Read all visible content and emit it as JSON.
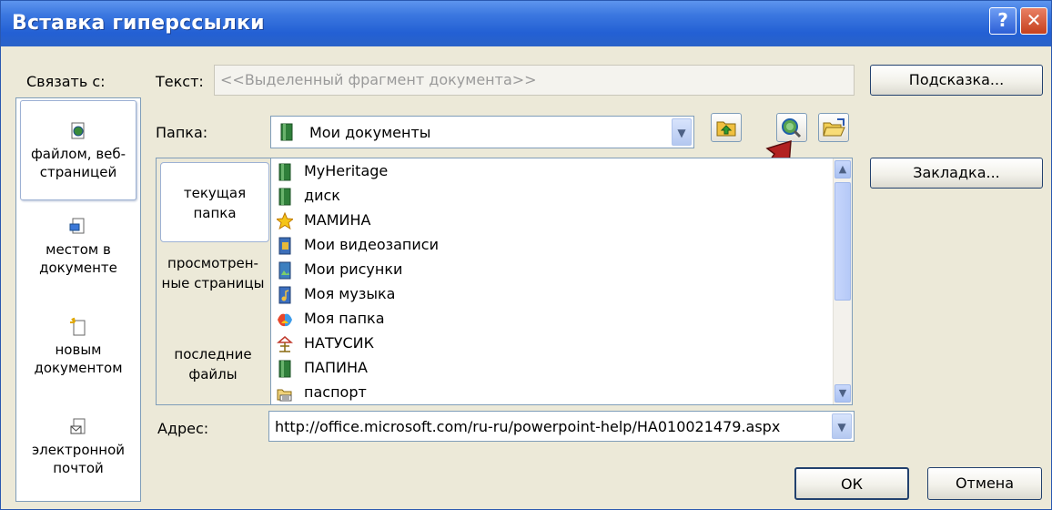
{
  "window": {
    "title": "Вставка гиперссылки",
    "help_glyph": "?",
    "close_glyph": "✕"
  },
  "link_to": {
    "label": "Связать с:",
    "items": [
      {
        "label": "файлом, веб-страницей",
        "icon": "web-page-icon",
        "selected": true
      },
      {
        "label": "местом в документе",
        "icon": "document-place-icon",
        "selected": false
      },
      {
        "label": "новым документом",
        "icon": "new-document-icon",
        "selected": false
      },
      {
        "label": "электронной почтой",
        "icon": "email-icon",
        "selected": false
      }
    ]
  },
  "text_field": {
    "label": "Текст:",
    "value": "<<Выделенный фрагмент документа>>"
  },
  "tooltip_button": "Подсказка...",
  "bookmark_button": "Закладка...",
  "folder": {
    "label": "Папка:",
    "value": "Мои документы",
    "icon": "folder-icon"
  },
  "toolbar_icons": [
    "up-folder-icon",
    "browse-web-icon",
    "browse-file-icon"
  ],
  "nav": {
    "items": [
      {
        "label": "текущая папка",
        "selected": true
      },
      {
        "label": "просмотрен-ные страницы",
        "selected": false
      },
      {
        "label": "последние файлы",
        "selected": false
      }
    ]
  },
  "files": [
    {
      "name": "MyHeritage",
      "icon": "folder-icon"
    },
    {
      "name": "диск",
      "icon": "folder-icon"
    },
    {
      "name": "МАМИНА",
      "icon": "star-folder-icon"
    },
    {
      "name": "Мои видеозаписи",
      "icon": "video-folder-icon"
    },
    {
      "name": "Мои рисунки",
      "icon": "pictures-folder-icon"
    },
    {
      "name": "Моя музыка",
      "icon": "music-folder-icon"
    },
    {
      "name": "Моя папка",
      "icon": "colorful-folder-icon"
    },
    {
      "name": "НАТУСИК",
      "icon": "network-folder-icon"
    },
    {
      "name": "ПАПИНА",
      "icon": "folder-icon"
    },
    {
      "name": "паспорт",
      "icon": "shared-folder-icon"
    }
  ],
  "address": {
    "label": "Адрес:",
    "value": "http://office.microsoft.com/ru-ru/powerpoint-help/HA010021479.aspx"
  },
  "ok_button": "ОК",
  "cancel_button": "Отмена",
  "colors": {
    "title_bar": "#2360d4",
    "dialog_bg": "#ece9d8",
    "border": "#7f9db9",
    "arrow": "#b22222"
  }
}
